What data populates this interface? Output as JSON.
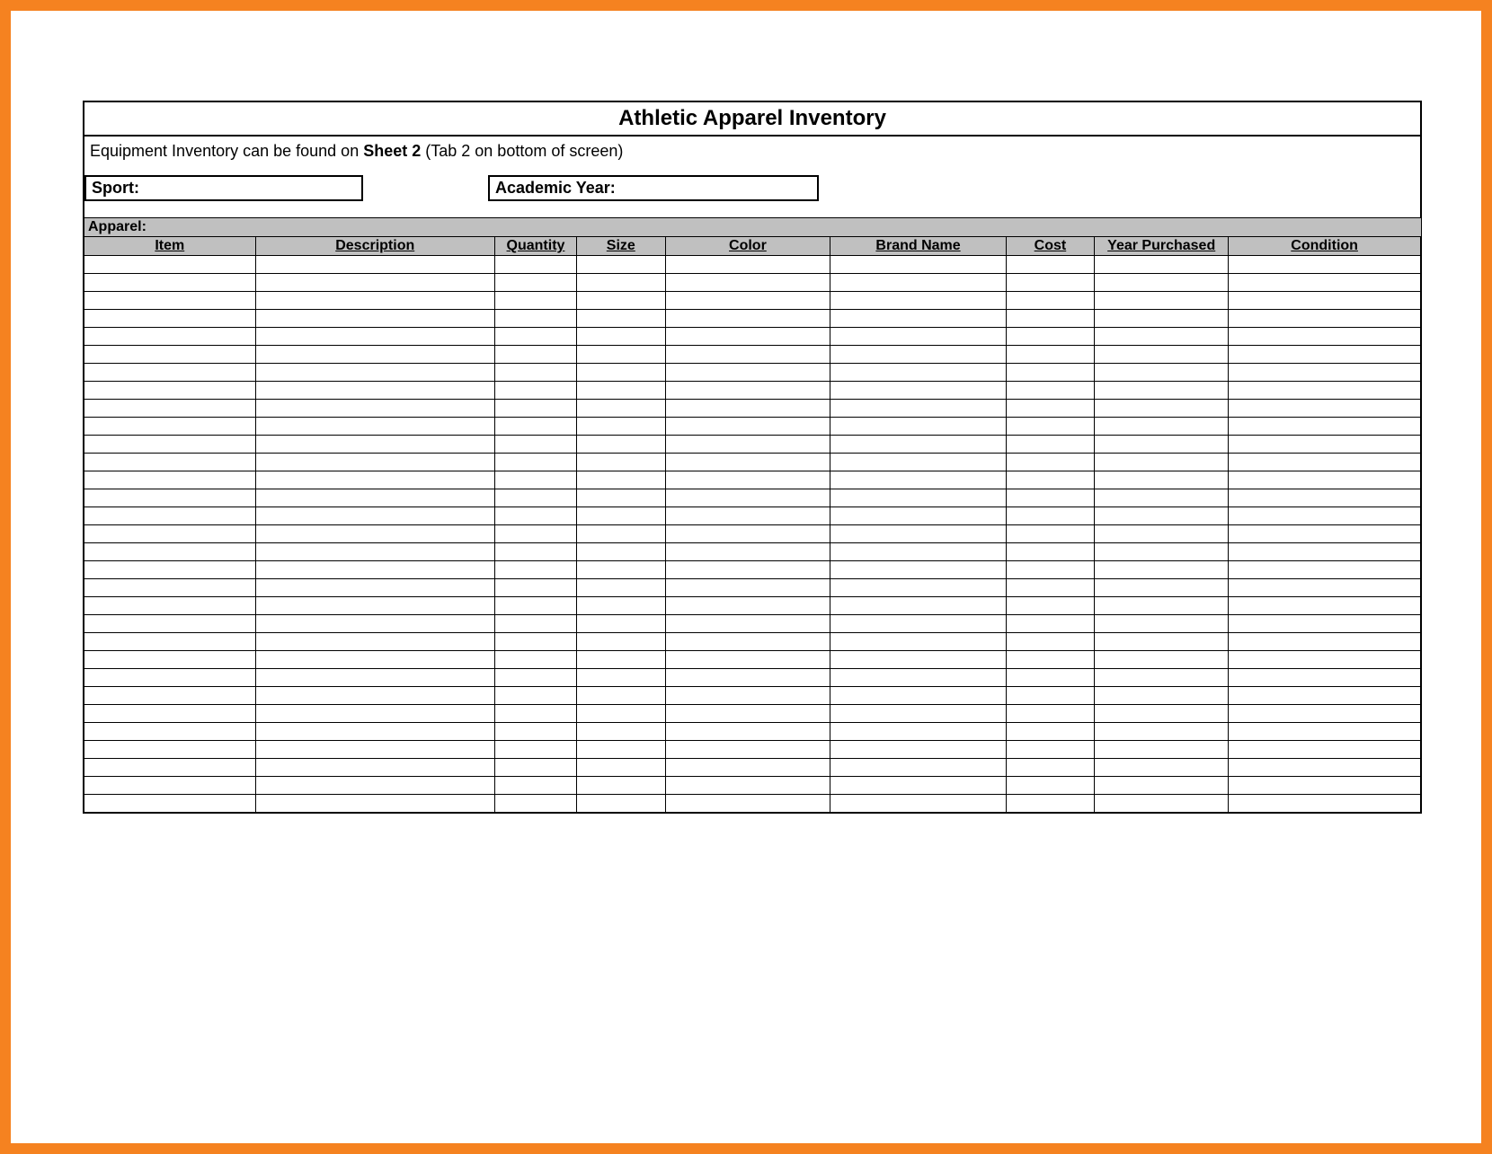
{
  "title": "Athletic Apparel Inventory",
  "hint_prefix": "Equipment Inventory can be found on ",
  "hint_bold": "Sheet 2",
  "hint_suffix": " (Tab 2 on bottom of screen)",
  "fields": {
    "sport_label": "Sport:",
    "sport_value": "",
    "academic_year_label": "Academic Year:",
    "academic_year_value": ""
  },
  "section_label": "Apparel:",
  "columns": {
    "item": "Item",
    "description": "Description",
    "quantity": "Quantity",
    "size": "Size",
    "color": "Color",
    "brand_name": "Brand Name",
    "cost": "Cost",
    "year_purchased": "Year Purchased",
    "condition": "Condition"
  },
  "row_count": 31,
  "colors": {
    "frame": "#f58220",
    "header_fill": "#c0c0c0"
  }
}
